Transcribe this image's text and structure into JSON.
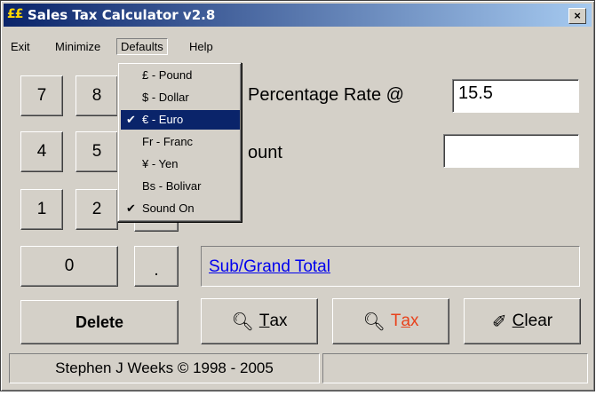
{
  "window": {
    "icon": "££",
    "title": "Sales Tax Calculator v2.8",
    "close_glyph": "×"
  },
  "menu": {
    "exit": "Exit",
    "minimize": "Minimize",
    "defaults": "Defaults",
    "help": "Help"
  },
  "defaults_menu": [
    {
      "label": "£ - Pound",
      "checked": false
    },
    {
      "label": "$ - Dollar",
      "checked": false
    },
    {
      "label": "€ - Euro",
      "checked": true
    },
    {
      "label": "Fr - Franc",
      "checked": false
    },
    {
      "label": "¥ - Yen",
      "checked": false
    },
    {
      "label": "Bs - Bolivar",
      "checked": false
    },
    {
      "label": "Sound On",
      "checked": true
    }
  ],
  "check_glyph": "✔",
  "keypad": {
    "k7": "7",
    "k8": "8",
    "k4": "4",
    "k5": "5",
    "k1": "1",
    "k2": "2",
    "k0": "0",
    "dot": "."
  },
  "rate": {
    "label": "Percentage Rate @",
    "value": "15.5"
  },
  "amount": {
    "label": "ount",
    "value": ""
  },
  "total_link": "Sub/Grand Total",
  "buttons": {
    "delete": "Delete",
    "add_tax_prefix": "",
    "add_tax_u": "T",
    "add_tax_rest": "ax",
    "remove_tax_prefix": "",
    "remove_tax_u": "a",
    "remove_tax_first": "T",
    "remove_tax_rest": "x",
    "clear_u": "C",
    "clear_rest": "lear"
  },
  "status": {
    "copyright": "Stephen J Weeks © 1998 - 2005",
    "extra": ""
  },
  "colors": {
    "title_start": "#0a246a",
    "title_end": "#a6caf0",
    "link": "#0000ee",
    "remove_tax_text": "#e8421c"
  }
}
